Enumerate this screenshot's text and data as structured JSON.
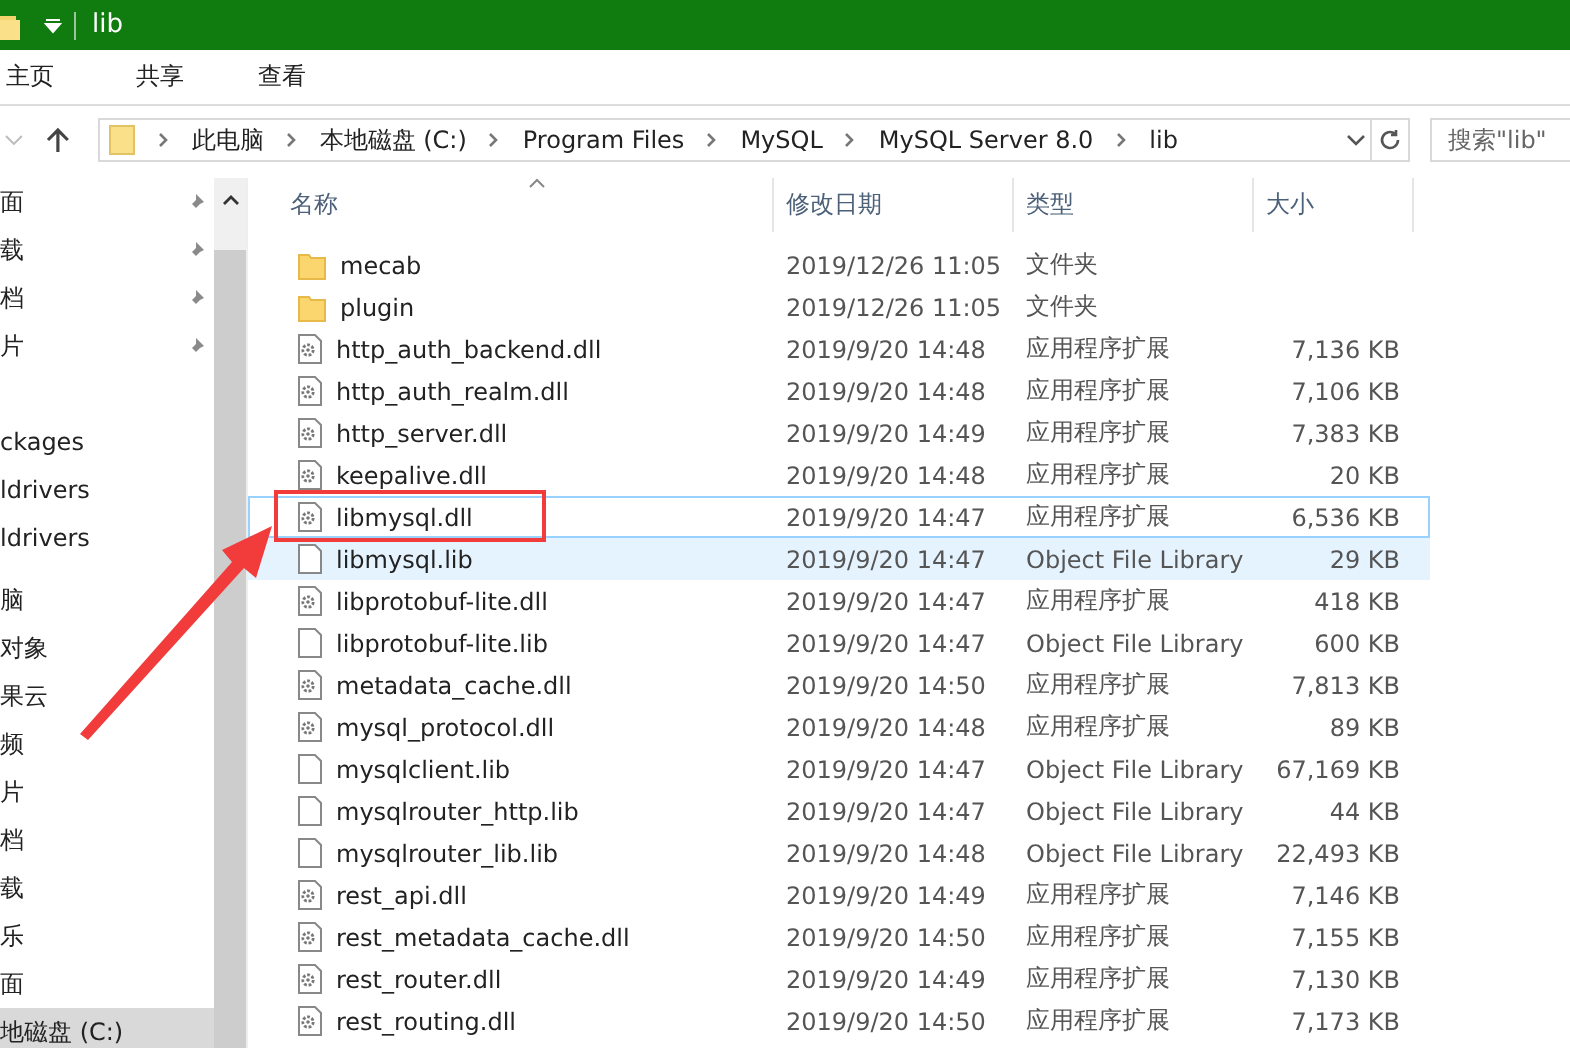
{
  "window": {
    "title": "lib"
  },
  "ribbon_tabs": [
    {
      "label": "主页"
    },
    {
      "label": "共享"
    },
    {
      "label": "查看"
    }
  ],
  "address_bar": {
    "path": [
      "此电脑",
      "本地磁盘 (C:)",
      "Program Files",
      "MySQL",
      "MySQL Server 8.0",
      "lib"
    ]
  },
  "search": {
    "placeholder": "搜索\"lib\""
  },
  "nav_pane": {
    "groups": [
      {
        "items": [
          {
            "label": "面",
            "pinned": true,
            "selected": false
          },
          {
            "label": "载",
            "pinned": true,
            "selected": false
          },
          {
            "label": "档",
            "pinned": true,
            "selected": false
          },
          {
            "label": "片",
            "pinned": true,
            "selected": false
          }
        ]
      },
      {
        "items": [
          {
            "label": "ckages",
            "pinned": false,
            "selected": false
          },
          {
            "label": "ldrivers",
            "pinned": false,
            "selected": false
          },
          {
            "label": "ldrivers",
            "pinned": false,
            "selected": false
          }
        ]
      },
      {
        "items": [
          {
            "label": "脑",
            "pinned": false,
            "selected": false
          },
          {
            "label": "对象",
            "pinned": false,
            "selected": false
          },
          {
            "label": "果云",
            "pinned": false,
            "selected": false
          },
          {
            "label": "频",
            "pinned": false,
            "selected": false
          },
          {
            "label": "片",
            "pinned": false,
            "selected": false
          },
          {
            "label": "档",
            "pinned": false,
            "selected": false
          },
          {
            "label": "载",
            "pinned": false,
            "selected": false
          },
          {
            "label": "乐",
            "pinned": false,
            "selected": false
          },
          {
            "label": "面",
            "pinned": false,
            "selected": false
          },
          {
            "label": "地磁盘 (C:)",
            "pinned": false,
            "selected": true
          }
        ]
      }
    ]
  },
  "columns": [
    "名称",
    "修改日期",
    "类型",
    "大小"
  ],
  "files": [
    {
      "kind": "folder",
      "name": "mecab",
      "modified": "2019/12/26 11:05",
      "type": "文件夹",
      "focused": false,
      "hovered": false
    },
    {
      "kind": "folder",
      "name": "plugin",
      "modified": "2019/12/26 11:05",
      "type": "文件夹",
      "focused": false,
      "hovered": false
    },
    {
      "kind": "dll",
      "name": "http_auth_backend.dll",
      "modified": "2019/9/20 14:48",
      "type": "应用程序扩展",
      "size": "7,136 KB",
      "focused": false,
      "hovered": false
    },
    {
      "kind": "dll",
      "name": "http_auth_realm.dll",
      "modified": "2019/9/20 14:48",
      "type": "应用程序扩展",
      "size": "7,106 KB",
      "focused": false,
      "hovered": false
    },
    {
      "kind": "dll",
      "name": "http_server.dll",
      "modified": "2019/9/20 14:49",
      "type": "应用程序扩展",
      "size": "7,383 KB",
      "focused": false,
      "hovered": false
    },
    {
      "kind": "dll",
      "name": "keepalive.dll",
      "modified": "2019/9/20 14:48",
      "type": "应用程序扩展",
      "size": "20 KB",
      "focused": false,
      "hovered": false
    },
    {
      "kind": "dll",
      "name": "libmysql.dll",
      "modified": "2019/9/20 14:47",
      "type": "应用程序扩展",
      "size": "6,536 KB",
      "focused": true,
      "hovered": false
    },
    {
      "kind": "lib",
      "name": "libmysql.lib",
      "modified": "2019/9/20 14:47",
      "type": "Object File Library",
      "size": "29 KB",
      "focused": false,
      "hovered": true
    },
    {
      "kind": "dll",
      "name": "libprotobuf-lite.dll",
      "modified": "2019/9/20 14:47",
      "type": "应用程序扩展",
      "size": "418 KB",
      "focused": false,
      "hovered": false
    },
    {
      "kind": "lib",
      "name": "libprotobuf-lite.lib",
      "modified": "2019/9/20 14:47",
      "type": "Object File Library",
      "size": "600 KB",
      "focused": false,
      "hovered": false
    },
    {
      "kind": "dll",
      "name": "metadata_cache.dll",
      "modified": "2019/9/20 14:50",
      "type": "应用程序扩展",
      "size": "7,813 KB",
      "focused": false,
      "hovered": false
    },
    {
      "kind": "dll",
      "name": "mysql_protocol.dll",
      "modified": "2019/9/20 14:48",
      "type": "应用程序扩展",
      "size": "89 KB",
      "focused": false,
      "hovered": false
    },
    {
      "kind": "lib",
      "name": "mysqlclient.lib",
      "modified": "2019/9/20 14:47",
      "type": "Object File Library",
      "size": "67,169 KB",
      "focused": false,
      "hovered": false
    },
    {
      "kind": "lib",
      "name": "mysqlrouter_http.lib",
      "modified": "2019/9/20 14:47",
      "type": "Object File Library",
      "size": "44 KB",
      "focused": false,
      "hovered": false
    },
    {
      "kind": "lib",
      "name": "mysqlrouter_lib.lib",
      "modified": "2019/9/20 14:48",
      "type": "Object File Library",
      "size": "22,493 KB",
      "focused": false,
      "hovered": false
    },
    {
      "kind": "dll",
      "name": "rest_api.dll",
      "modified": "2019/9/20 14:49",
      "type": "应用程序扩展",
      "size": "7,146 KB",
      "focused": false,
      "hovered": false
    },
    {
      "kind": "dll",
      "name": "rest_metadata_cache.dll",
      "modified": "2019/9/20 14:50",
      "type": "应用程序扩展",
      "size": "7,155 KB",
      "focused": false,
      "hovered": false
    },
    {
      "kind": "dll",
      "name": "rest_router.dll",
      "modified": "2019/9/20 14:49",
      "type": "应用程序扩展",
      "size": "7,130 KB",
      "focused": false,
      "hovered": false
    },
    {
      "kind": "dll",
      "name": "rest_routing.dll",
      "modified": "2019/9/20 14:50",
      "type": "应用程序扩展",
      "size": "7,173 KB",
      "focused": false,
      "hovered": false
    }
  ]
}
